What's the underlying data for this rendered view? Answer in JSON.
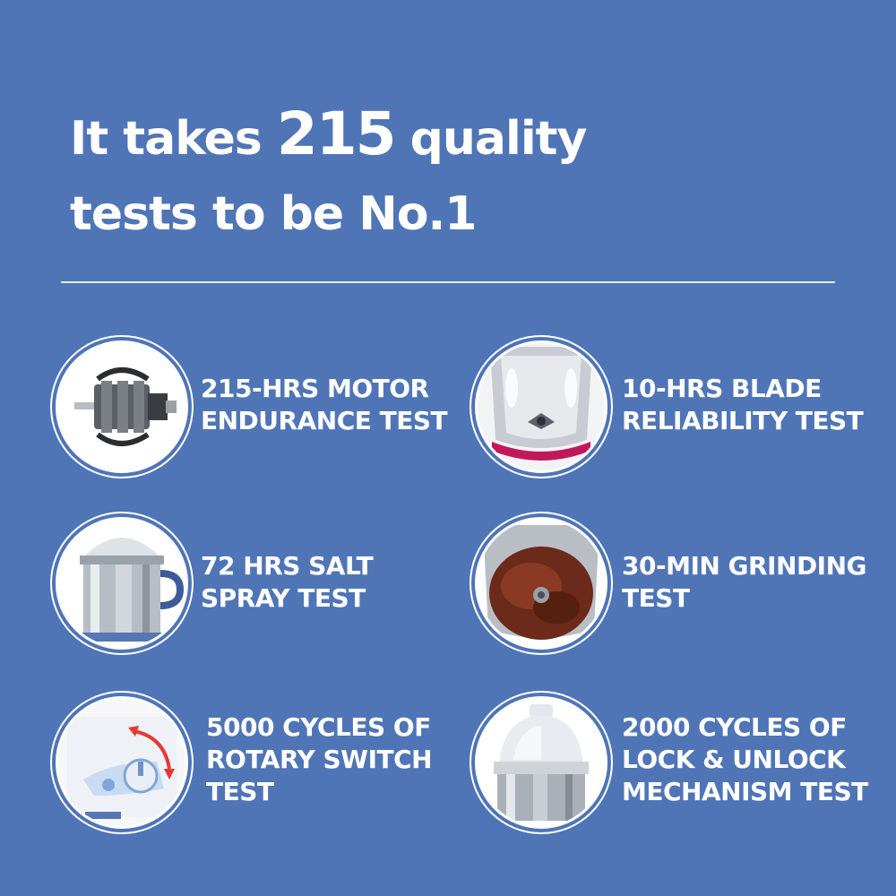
{
  "headline": {
    "line1_before": "It takes",
    "line1_number": "215",
    "line1_after": "quality",
    "line2": "tests to be No.1"
  },
  "tests": [
    {
      "icon": "motor-icon",
      "line1": "215-HRS MOTOR",
      "line2": "ENDURANCE TEST"
    },
    {
      "icon": "blade-jar-icon",
      "line1": "10-HRS BLADE",
      "line2": "RELIABILITY TEST"
    },
    {
      "icon": "steel-jar-icon",
      "line1": "72 HRS SALT",
      "line2": "SPRAY TEST"
    },
    {
      "icon": "grinding-paste-icon",
      "line1": "30-MIN GRINDING",
      "line2": "TEST"
    },
    {
      "icon": "rotary-switch-icon",
      "line1": "5000 CYCLES OF",
      "line2": "ROTARY SWITCH",
      "line3": "TEST"
    },
    {
      "icon": "jar-lid-icon",
      "line1": "2000 CYCLES OF",
      "line2": "LOCK & UNLOCK",
      "line3": "MECHANISM TEST"
    }
  ],
  "colors": {
    "background": "#4f75b7",
    "text": "#ffffff"
  }
}
